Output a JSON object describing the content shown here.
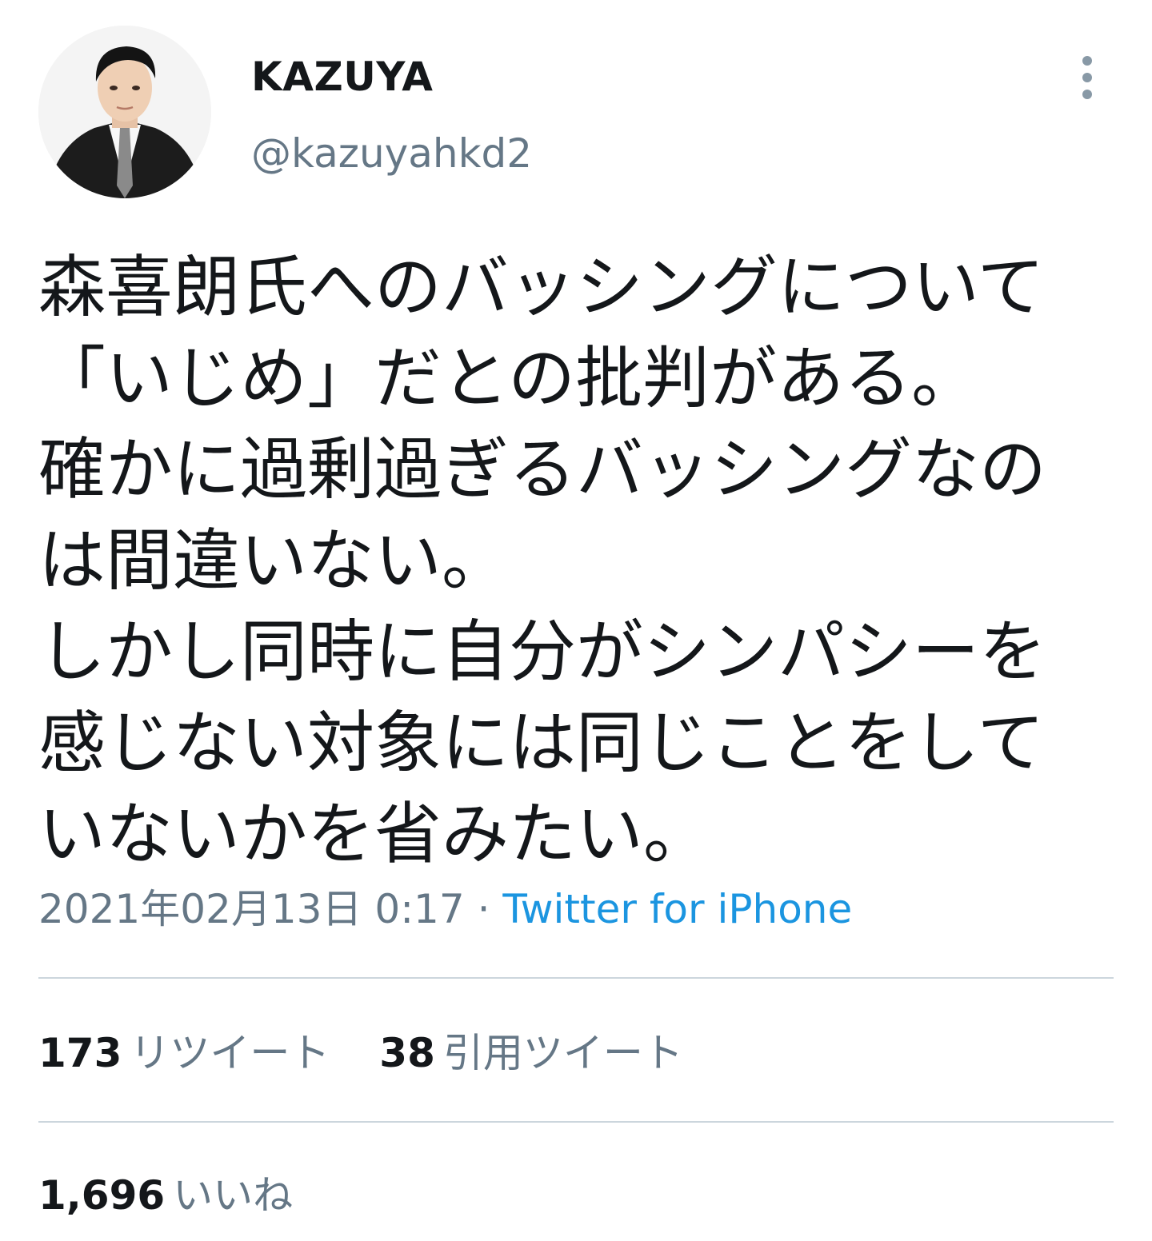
{
  "user": {
    "display_name": "KAZUYA",
    "handle": "@kazuyahkd2",
    "avatar_icon": "profile-photo"
  },
  "tweet": {
    "lines": [
      "森喜朗氏へのバッシングについて",
      "「いじめ」だとの批判がある。",
      "確かに過剰過ぎるバッシングなの",
      "は間違いない。",
      "しかし同時に自分がシンパシーを",
      "感じない対象には同じことをして",
      "いないかを省みたい。"
    ],
    "timestamp": "2021年02月13日 0:17",
    "separator": " · ",
    "source": "Twitter for iPhone"
  },
  "stats": {
    "retweets": {
      "count": "173",
      "label": "リツイート"
    },
    "quotes": {
      "count": "38",
      "label": "引用ツイート"
    },
    "likes": {
      "count": "1,696",
      "label": "いいね"
    }
  },
  "colors": {
    "text": "#14171a",
    "secondary": "#657786",
    "link": "#1b95e0",
    "divider": "#ccd6dd"
  }
}
